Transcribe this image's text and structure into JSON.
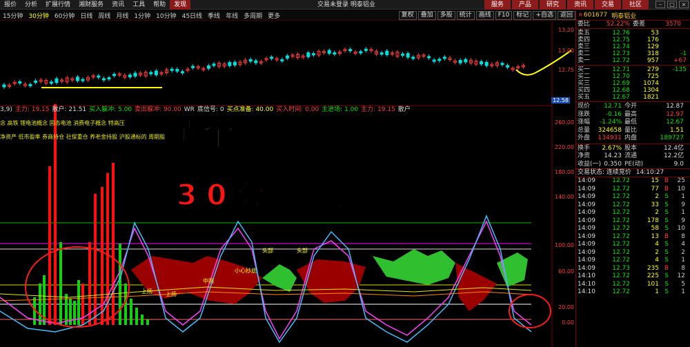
{
  "menu": {
    "items": [
      "报价",
      "分析",
      "扩展行情",
      "湘财服务",
      "资讯",
      "工具",
      "帮助",
      "发现"
    ],
    "active_index": 7,
    "center_title": "交易未登录  明泰铝业",
    "right_tabs": [
      "服务",
      "产品",
      "研究",
      "资讯",
      "交易",
      "社区"
    ]
  },
  "periods": {
    "items": [
      "15分钟",
      "30分钟",
      "60分钟",
      "日线",
      "周线",
      "月线",
      "1分钟",
      "10分钟",
      "45日线",
      "季线",
      "年线",
      "多周期",
      "更多"
    ],
    "selected_index": 1,
    "tools": [
      "复权",
      "叠加",
      "多股",
      "统计",
      "画线",
      "F10",
      "标记",
      "+自选",
      "返回"
    ]
  },
  "chart": {
    "price_axis": [
      "13.20",
      "13.00",
      "12.75",
      "12.58"
    ],
    "indicator_axis": [
      "260.00",
      "220.00",
      "180.00",
      "140.00",
      "100.00",
      "60.00",
      "20.00",
      "0.00"
    ],
    "price_tag": "12.58",
    "indicator_header": [
      {
        "text": "3,9)",
        "color": "#ddd"
      },
      {
        "text": "主力: 19.15",
        "color": "#ff3c3c"
      },
      {
        "text": "散户: 21.51",
        "color": "#ddd"
      },
      {
        "text": "买入躲冲: 5.00",
        "color": "#00e400"
      },
      {
        "text": "卖出躲冲: 90.00",
        "color": "#ff3c3c"
      },
      {
        "text": "WR",
        "color": "#ddd"
      },
      {
        "text": "底信号: 0",
        "color": "#ddd"
      },
      {
        "text": "买点准备: 40.00",
        "color": "#ffff00"
      },
      {
        "text": "买入时间: 0.00",
        "color": "#ff3c3c"
      },
      {
        "text": "主进场: 1.00",
        "color": "#00e400"
      },
      {
        "text": "主力: 19.15",
        "color": "#ff3c3c"
      },
      {
        "text": "散户",
        "color": "#ddd"
      }
    ],
    "tag_rows": [
      "念 高铁 锂电池概念 固态电池 消费电子概念 特高压",
      "净资产 低市盈率 券商持仓 社保重仓 养老金持股 沪股通标的 周期股"
    ],
    "annotations": [
      "头部",
      "头部",
      "小心抄底",
      "上扬",
      "上扬",
      "中阴"
    ],
    "overlay_line1": "黄金买点",
    "overlay_line2a": "30分时",
    "overlay_line2b": "狙击图"
  },
  "panel": {
    "rq_badge": "R",
    "code": "601677",
    "name": "明泰铝业",
    "weibi": {
      "label": "委比",
      "value": "52.22%",
      "label2": "委差",
      "value2": "3570"
    },
    "sell": [
      {
        "label": "卖五",
        "price": "12.76",
        "vol": "53",
        "extra": ""
      },
      {
        "label": "卖四",
        "price": "12.75",
        "vol": "176",
        "extra": ""
      },
      {
        "label": "卖三",
        "price": "12.74",
        "vol": "129",
        "extra": ""
      },
      {
        "label": "卖二",
        "price": "12.73",
        "vol": "318",
        "extra": "-1"
      },
      {
        "label": "卖一",
        "price": "12.72",
        "vol": "957",
        "extra": "+67"
      }
    ],
    "buy": [
      {
        "label": "买一",
        "price": "12.71",
        "vol": "279",
        "extra": "-135"
      },
      {
        "label": "买二",
        "price": "12.70",
        "vol": "725",
        "extra": ""
      },
      {
        "label": "买三",
        "price": "12.69",
        "vol": "1074",
        "extra": ""
      },
      {
        "label": "买四",
        "price": "12.68",
        "vol": "1304",
        "extra": ""
      },
      {
        "label": "买五",
        "price": "12.67",
        "vol": "1821",
        "extra": ""
      }
    ],
    "quote": [
      {
        "k1": "现价",
        "v1": "12.71",
        "c1": "green",
        "k2": "今开",
        "v2": "12.87",
        "c2": "white"
      },
      {
        "k1": "涨跌",
        "v1": "-0.16",
        "c1": "green",
        "k2": "最高",
        "v2": "12.97",
        "c2": "red"
      },
      {
        "k1": "涨幅",
        "v1": "-1.24%",
        "c1": "green",
        "k2": "最低",
        "v2": "12.67",
        "c2": "green"
      },
      {
        "k1": "总量",
        "v1": "324658",
        "c1": "yellow",
        "k2": "量比",
        "v2": "1.51",
        "c2": "yellow"
      },
      {
        "k1": "外盘",
        "v1": "134931",
        "c1": "red",
        "k2": "内盘",
        "v2": "189727",
        "c2": "green"
      }
    ],
    "quote2": [
      {
        "k1": "换手",
        "v1": "2.67%",
        "c1": "yellow",
        "k2": "股本",
        "v2": "12.4亿",
        "c2": "white"
      },
      {
        "k1": "净资",
        "v1": "14.23",
        "c1": "white",
        "k2": "流通",
        "v2": "12.2亿",
        "c2": "white"
      },
      {
        "k1": "收益(一)",
        "v1": "0.350",
        "c1": "white",
        "k2": "PE(动)",
        "v2": "9.0",
        "c2": "white"
      }
    ],
    "status_label": "交易状态: 连续竞价",
    "status_time": "14:10:27",
    "ticks": [
      {
        "t": "14:09",
        "p": "12.72",
        "v": "15",
        "d": "B",
        "x": "25"
      },
      {
        "t": "14:09",
        "p": "12.72",
        "v": "77",
        "d": "B",
        "x": "10"
      },
      {
        "t": "14:09",
        "p": "12.72",
        "v": "2",
        "d": "S",
        "x": "1"
      },
      {
        "t": "14:09",
        "p": "12.72",
        "v": "33",
        "d": "S",
        "x": "9"
      },
      {
        "t": "14:09",
        "p": "12.72",
        "v": "2",
        "d": "S",
        "x": "1"
      },
      {
        "t": "14:09",
        "p": "12.72",
        "v": "178",
        "d": "S",
        "x": "9"
      },
      {
        "t": "14:09",
        "p": "12.72",
        "v": "58",
        "d": "S",
        "x": "10"
      },
      {
        "t": "14:09",
        "p": "12.72",
        "v": "13",
        "d": "B",
        "x": "8"
      },
      {
        "t": "14:09",
        "p": "12.72",
        "v": "4",
        "d": "S",
        "x": "4"
      },
      {
        "t": "14:09",
        "p": "12.72",
        "v": "2",
        "d": "S",
        "x": "2"
      },
      {
        "t": "14:09",
        "p": "12.72",
        "v": "4",
        "d": "S",
        "x": "1"
      },
      {
        "t": "14:09",
        "p": "12.73",
        "v": "235",
        "d": "B",
        "x": "8"
      },
      {
        "t": "14:10",
        "p": "12.72",
        "v": "225",
        "d": "S",
        "x": "12"
      },
      {
        "t": "14:10",
        "p": "12.72",
        "v": "101",
        "d": "S",
        "x": "5"
      },
      {
        "t": "14:10",
        "p": "12.72",
        "v": "1",
        "d": "S",
        "x": "1"
      }
    ]
  }
}
